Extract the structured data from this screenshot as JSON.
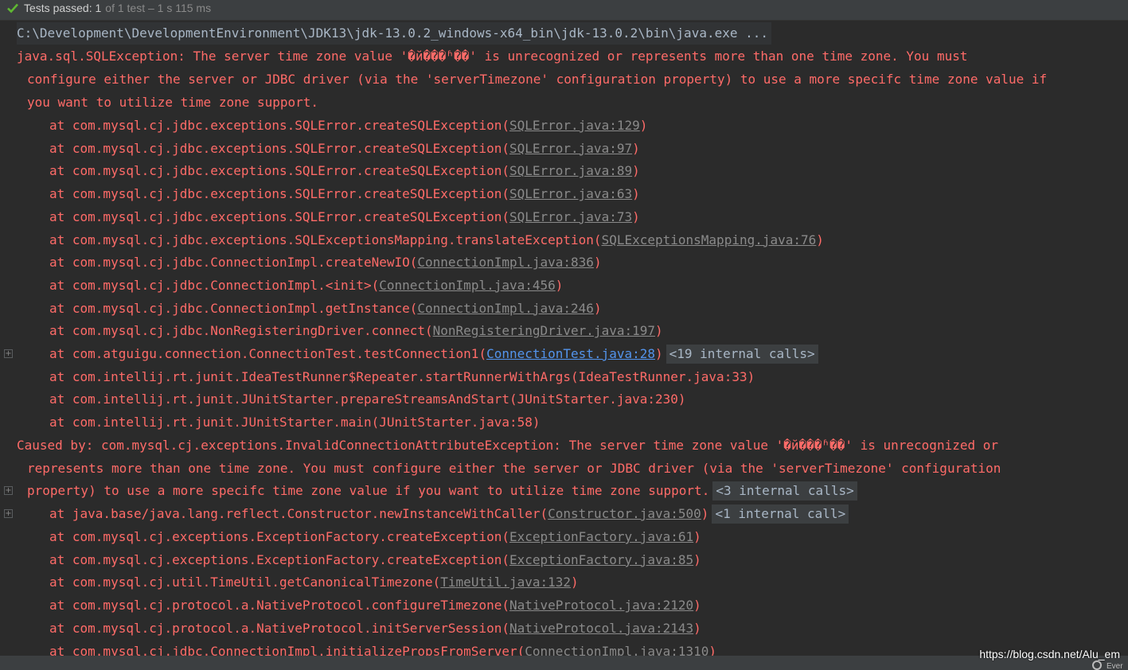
{
  "status": {
    "main": "Tests passed: 1",
    "sub": "of 1 test – 1 s 115 ms",
    "icon": "check-icon",
    "color": "#5fb832"
  },
  "console": {
    "command": "C:\\Development\\DevelopmentEnvironment\\JDK13\\jdk-13.0.2_windows-x64_bin\\jdk-13.0.2\\bin\\java.exe ...",
    "exception_lines": [
      "java.sql.SQLException: The server time zone value '�й���ʱ��' is unrecognized or represents more than one time zone. You must",
      "configure either the server or JDBC driver (via the 'serverTimezone' configuration property) to use a more specifc time zone value if",
      "you want to utilize time zone support."
    ],
    "frames1": [
      {
        "prefix": "at com.mysql.cj.jdbc.exceptions.SQLError.createSQLException(",
        "link": "SQLError.java:129",
        "suffix": ")"
      },
      {
        "prefix": "at com.mysql.cj.jdbc.exceptions.SQLError.createSQLException(",
        "link": "SQLError.java:97",
        "suffix": ")"
      },
      {
        "prefix": "at com.mysql.cj.jdbc.exceptions.SQLError.createSQLException(",
        "link": "SQLError.java:89",
        "suffix": ")"
      },
      {
        "prefix": "at com.mysql.cj.jdbc.exceptions.SQLError.createSQLException(",
        "link": "SQLError.java:63",
        "suffix": ")"
      },
      {
        "prefix": "at com.mysql.cj.jdbc.exceptions.SQLError.createSQLException(",
        "link": "SQLError.java:73",
        "suffix": ")"
      },
      {
        "prefix": "at com.mysql.cj.jdbc.exceptions.SQLExceptionsMapping.translateException(",
        "link": "SQLExceptionsMapping.java:76",
        "suffix": ")"
      },
      {
        "prefix": "at com.mysql.cj.jdbc.ConnectionImpl.createNewIO(",
        "link": "ConnectionImpl.java:836",
        "suffix": ")"
      },
      {
        "prefix": "at com.mysql.cj.jdbc.ConnectionImpl.<init>(",
        "link": "ConnectionImpl.java:456",
        "suffix": ")"
      },
      {
        "prefix": "at com.mysql.cj.jdbc.ConnectionImpl.getInstance(",
        "link": "ConnectionImpl.java:246",
        "suffix": ")"
      },
      {
        "prefix": "at com.mysql.cj.jdbc.NonRegisteringDriver.connect(",
        "link": "NonRegisteringDriver.java:197",
        "suffix": ")"
      }
    ],
    "test_frame": {
      "prefix": "at com.atguigu.connection.ConnectionTest.testConnection1(",
      "link": "ConnectionTest.java:28",
      "suffix": ")",
      "internal": "<19 internal calls>"
    },
    "runner_frames": [
      "at com.intellij.rt.junit.IdeaTestRunner$Repeater.startRunnerWithArgs(IdeaTestRunner.java:33)",
      "at com.intellij.rt.junit.JUnitStarter.prepareStreamsAndStart(JUnitStarter.java:230)",
      "at com.intellij.rt.junit.JUnitStarter.main(JUnitStarter.java:58)"
    ],
    "caused_by_lines": [
      "Caused by: com.mysql.cj.exceptions.InvalidConnectionAttributeException: The server time zone value '�й���ʱ��' is unrecognized or",
      "represents more than one time zone. You must configure either the server or JDBC driver (via the 'serverTimezone' configuration",
      "property) to use a more specifc time zone value if you want to utilize time zone support."
    ],
    "caused_internal": "<3 internal calls>",
    "constructor_frame": {
      "prefix": "at java.base/java.lang.reflect.Constructor.newInstanceWithCaller(",
      "link": "Constructor.java:500",
      "suffix": ")",
      "internal": "<1 internal call>"
    },
    "frames2": [
      {
        "prefix": "at com.mysql.cj.exceptions.ExceptionFactory.createException(",
        "link": "ExceptionFactory.java:61",
        "suffix": ")"
      },
      {
        "prefix": "at com.mysql.cj.exceptions.ExceptionFactory.createException(",
        "link": "ExceptionFactory.java:85",
        "suffix": ")"
      },
      {
        "prefix": "at com.mysql.cj.util.TimeUtil.getCanonicalTimezone(",
        "link": "TimeUtil.java:132",
        "suffix": ")"
      },
      {
        "prefix": "at com.mysql.cj.protocol.a.NativeProtocol.configureTimezone(",
        "link": "NativeProtocol.java:2120",
        "suffix": ")"
      },
      {
        "prefix": "at com.mysql.cj.protocol.a.NativeProtocol.initServerSession(",
        "link": "NativeProtocol.java:2143",
        "suffix": ")"
      },
      {
        "prefix": "at com.mysql.cj.jdbc.ConnectionImpl.initializePropsFromServer(",
        "link": "ConnectionImpl.java:1310",
        "suffix": ")"
      }
    ]
  },
  "watermark": "https://blog.csdn.net/Alu_em",
  "event_log_label": "Ever"
}
